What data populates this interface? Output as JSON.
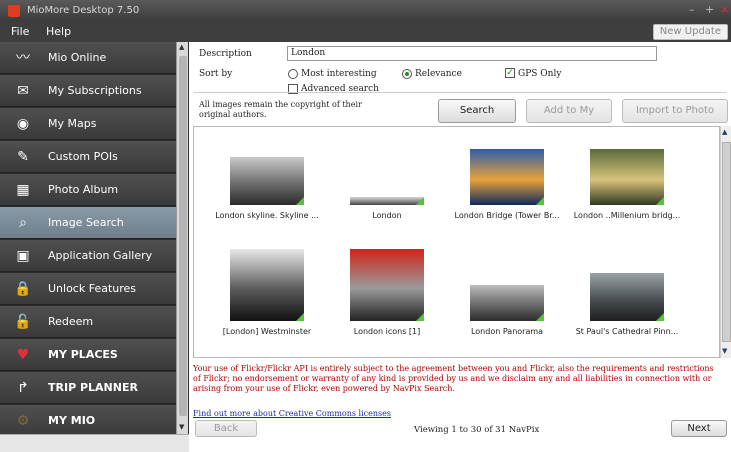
{
  "window": {
    "title": "MioMore Desktop 7.50"
  },
  "menu": {
    "file": "File",
    "help": "Help",
    "new_update": "New Update"
  },
  "sidebar": {
    "items": [
      {
        "label": "Mio Online",
        "icon": "mio-online-icon",
        "glyph": "〰"
      },
      {
        "label": "My Subscriptions",
        "icon": "envelope-icon",
        "glyph": "✉"
      },
      {
        "label": "My Maps",
        "icon": "map-pin-icon",
        "glyph": "◉"
      },
      {
        "label": "Custom POIs",
        "icon": "custom-poi-icon",
        "glyph": "✎"
      },
      {
        "label": "Photo Album",
        "icon": "photo-album-icon",
        "glyph": "▦"
      },
      {
        "label": "Image Search",
        "icon": "camera-icon",
        "glyph": "⌕"
      },
      {
        "label": "Application Gallery",
        "icon": "app-gallery-icon",
        "glyph": "▣"
      },
      {
        "label": "Unlock Features",
        "icon": "lock-icon",
        "glyph": "🔒"
      },
      {
        "label": "Redeem",
        "icon": "redeem-icon",
        "glyph": "🔓"
      },
      {
        "label": "MY PLACES",
        "icon": "heart-icon",
        "glyph": "♥"
      },
      {
        "label": "TRIP PLANNER",
        "icon": "trip-planner-icon",
        "glyph": "↱"
      },
      {
        "label": "MY MIO",
        "icon": "gear-icon",
        "glyph": "⚙"
      }
    ],
    "active_index": 5
  },
  "search": {
    "description_label": "Description",
    "description_value": "London",
    "sort_label": "Sort by",
    "sort_options": [
      "Most interesting",
      "Relevance"
    ],
    "sort_selected": "Relevance",
    "gps_only_label": "GPS Only",
    "gps_only_checked": true,
    "advanced_label": "Advanced search",
    "advanced_checked": false,
    "copyright_note": "All images remain the copyright of their original authors.",
    "search_button": "Search",
    "add_places_button": "Add to My Places",
    "import_button": "Import to Photo Album"
  },
  "results": [
    {
      "caption": "London skyline. Skyline ...",
      "palette": [
        "#c8c8c8",
        "#6e6e6e",
        "#2a2a2a"
      ]
    },
    {
      "caption": "London",
      "palette": [
        "#d8d8d8",
        "#8a8a8a",
        "#444444"
      ]
    },
    {
      "caption": "London Bridge (Tower Br...",
      "palette": [
        "#2d5da8",
        "#e8a23a",
        "#0f2a5c"
      ]
    },
    {
      "caption": "London ..Millenium bridg...",
      "palette": [
        "#5a6b3c",
        "#d8c27a",
        "#2f3a22"
      ]
    },
    {
      "caption": "[London] Westminster",
      "palette": [
        "#e8e8e8",
        "#5c5c5c",
        "#111111"
      ]
    },
    {
      "caption": "London icons [1]",
      "palette": [
        "#d0261c",
        "#9a9a9a",
        "#222222"
      ]
    },
    {
      "caption": "London Panorama",
      "palette": [
        "#bcbcbc",
        "#6a6a6a",
        "#2c2c2c"
      ]
    },
    {
      "caption": "St Paul's Cathedral Pinn...",
      "palette": [
        "#9aa4a8",
        "#4a4f52",
        "#1c1e20"
      ]
    }
  ],
  "footer": {
    "disclaimer": "Your use of Flickr/Flickr API is entirely subject to the agreement between you and Flickr, also the requirements and restrictions of Flickr; no endorsement or warranty of any kind is provided by us and we disclaim any and all liabilities in connection with or arising from your use of Flickr, even powered by NavPix Search.",
    "cc_link": "Find out more about Creative Commons licenses",
    "back_button": "Back",
    "viewing": "Viewing 1 to 30 of 31 NavPix",
    "next_button": "Next"
  }
}
